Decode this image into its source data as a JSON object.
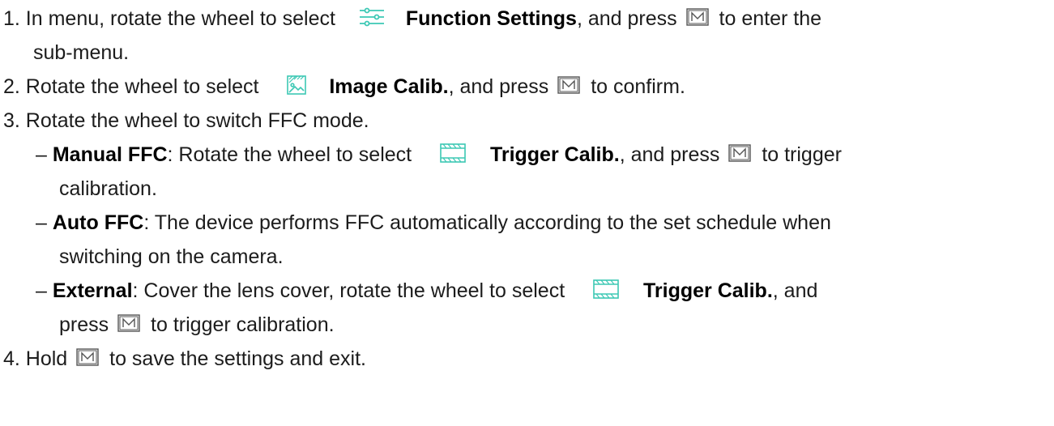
{
  "accent_color": "#3cc8b4",
  "icons": {
    "function_settings": "sliders-icon",
    "image_calib": "image-calibration-icon",
    "trigger_calib": "trigger-calibration-icon",
    "m_button": "m-button-icon"
  },
  "steps": {
    "s1": {
      "text_a": "1. In menu, rotate the wheel to select",
      "bold": "Function Settings",
      "text_b": ", and press",
      "text_c": "to enter the",
      "cont": "sub-menu."
    },
    "s2": {
      "text_a": "2. Rotate the wheel to select",
      "bold": "Image Calib.",
      "text_b": ", and press",
      "text_c": "to confirm."
    },
    "s3": {
      "text": "3. Rotate the wheel to switch FFC mode."
    },
    "s4": {
      "text_a": "4. Hold",
      "text_b": "to save the settings and exit."
    }
  },
  "modes": {
    "manual": {
      "dash": "–",
      "label": "Manual FFC",
      "text_a": ": Rotate the wheel to select",
      "bold": "Trigger Calib.",
      "text_b": ", and press",
      "text_c": "to trigger",
      "cont": "calibration."
    },
    "auto": {
      "dash": "–",
      "label": "Auto FFC",
      "text_a": ": The device performs FFC automatically according to the set schedule when",
      "cont": "switching on the camera."
    },
    "external": {
      "dash": "–",
      "label": "External",
      "text_a": ": Cover the lens cover, rotate the wheel to select",
      "bold": "Trigger Calib.",
      "text_b": ", and",
      "cont_a": "press",
      "cont_b": "to trigger calibration."
    }
  }
}
